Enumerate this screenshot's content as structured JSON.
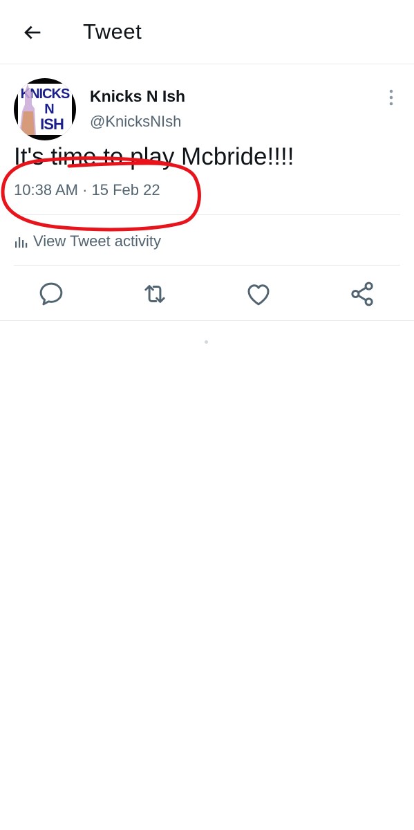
{
  "header": {
    "title": "Tweet",
    "back_icon": "arrow-left-icon"
  },
  "tweet": {
    "avatar_text": [
      "KNICKS",
      "N",
      "ISH"
    ],
    "display_name": "Knicks N Ish",
    "handle": "@KnicksNIsh",
    "text": "It's time to play Mcbride!!!!",
    "timestamp": "10:38 AM · 15 Feb 22"
  },
  "activity": {
    "label": "View Tweet activity",
    "icon": "bar-chart-icon"
  },
  "actions": [
    {
      "name": "reply",
      "icon": "reply-icon"
    },
    {
      "name": "retweet",
      "icon": "retweet-icon"
    },
    {
      "name": "like",
      "icon": "heart-icon"
    },
    {
      "name": "share",
      "icon": "share-icon"
    }
  ],
  "colors": {
    "text": "#0f1419",
    "secondary": "#536471",
    "divider": "#e7e9ea",
    "annotation": "#e8141c",
    "logo_blue": "#1a1f8a"
  }
}
